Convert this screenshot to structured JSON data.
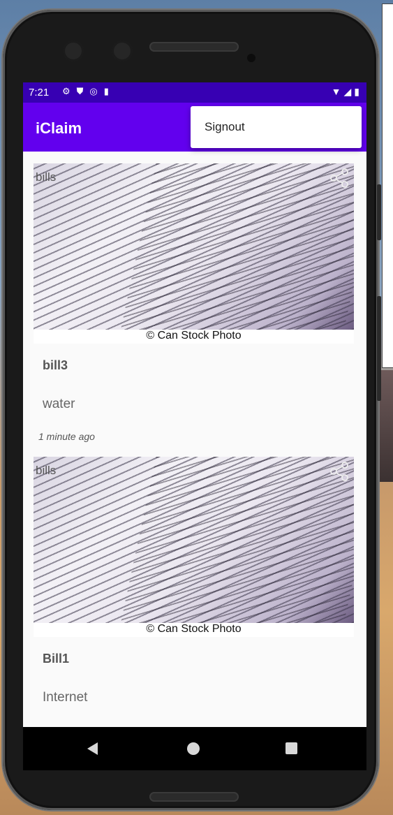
{
  "status_bar": {
    "time": "7:21",
    "left_icons": [
      "gear-icon",
      "shield-icon",
      "at-sign-icon",
      "sd-card-icon"
    ],
    "right_icons": [
      "wifi-icon",
      "signal-icon",
      "battery-icon"
    ]
  },
  "app_bar": {
    "title": "iClaim",
    "color": "#6200ee",
    "status_color": "#3700b3"
  },
  "overflow_menu": {
    "items": [
      {
        "label": "Signout"
      }
    ]
  },
  "claims": [
    {
      "category": "bills",
      "image_caption": "© Can Stock Photo",
      "title": "bill3",
      "description": "water",
      "timestamp": "1 minute ago"
    },
    {
      "category": "bills",
      "image_caption": "© Can Stock Photo",
      "title": "Bill1",
      "description": "Internet"
    }
  ],
  "nav_bar": {
    "buttons": [
      "back-icon",
      "home-icon",
      "recents-icon"
    ]
  }
}
